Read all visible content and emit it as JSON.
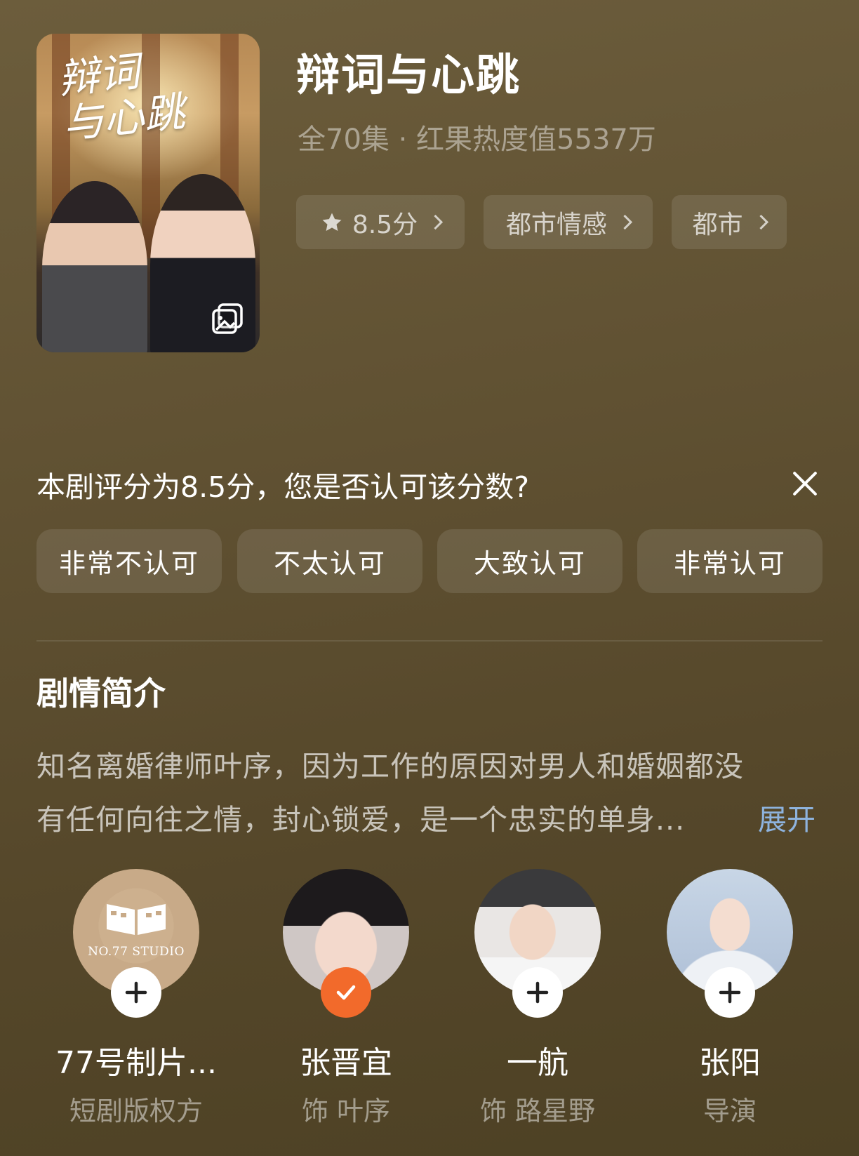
{
  "show": {
    "title": "辩词与心跳",
    "meta": "全70集 · 红果热度值5537万",
    "poster_title_art": "辩词\n与心跳",
    "tags": [
      {
        "label": "8.5分",
        "icon": "star-icon"
      },
      {
        "label": "都市情感"
      },
      {
        "label": "都市"
      }
    ]
  },
  "rating_prompt": {
    "question": "本剧评分为8.5分，您是否认可该分数?",
    "options": [
      "非常不认可",
      "不太认可",
      "大致认可",
      "非常认可"
    ]
  },
  "synopsis": {
    "heading": "剧情简介",
    "line1": "知名离婚律师叶序，因为工作的原因对男人和婚姻都没",
    "line2": "有任何向往之情，封心锁爱，是一个忠实的单身...",
    "expand_label": "展开"
  },
  "cast": [
    {
      "name": "77号制片...",
      "role": "短剧版权方",
      "followed": false,
      "avatar_text": "NO.77 STUDIO"
    },
    {
      "name": "张晋宜",
      "role": "饰 叶序",
      "followed": true
    },
    {
      "name": "一航",
      "role": "饰 路星野",
      "followed": false
    },
    {
      "name": "张阳",
      "role": "导演",
      "followed": false
    }
  ],
  "colors": {
    "background": "#615233",
    "accent_link": "#8eb3de",
    "followed_badge": "#f26a2b"
  }
}
